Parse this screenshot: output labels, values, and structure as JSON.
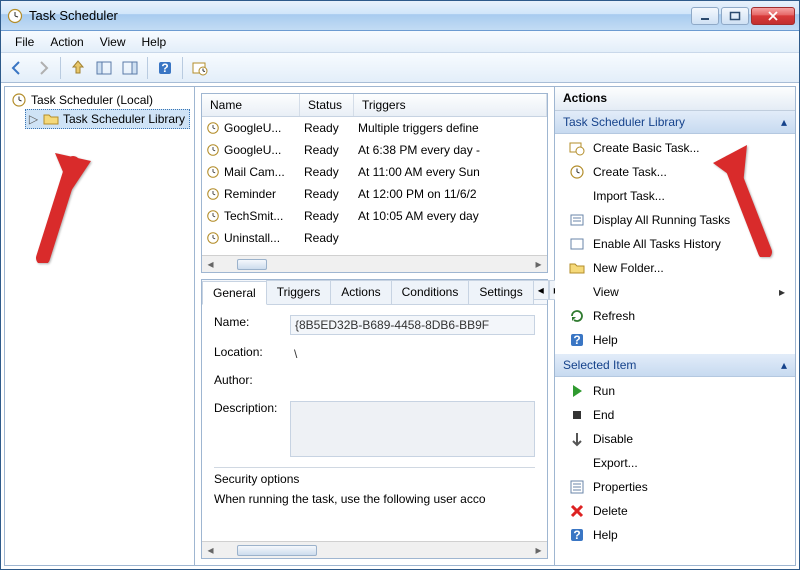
{
  "window": {
    "title": "Task Scheduler"
  },
  "menu": {
    "file": "File",
    "action": "Action",
    "view": "View",
    "help": "Help"
  },
  "tree": {
    "root": "Task Scheduler (Local)",
    "library": "Task Scheduler Library"
  },
  "columns": {
    "name": "Name",
    "status": "Status",
    "triggers": "Triggers"
  },
  "tasks": [
    {
      "name": "GoogleU...",
      "status": "Ready",
      "trigger": "Multiple triggers define"
    },
    {
      "name": "GoogleU...",
      "status": "Ready",
      "trigger": "At 6:38 PM every day - "
    },
    {
      "name": "Mail Cam...",
      "status": "Ready",
      "trigger": "At 11:00 AM every Sun"
    },
    {
      "name": "Reminder",
      "status": "Ready",
      "trigger": "At 12:00 PM on 11/6/2"
    },
    {
      "name": "TechSmit...",
      "status": "Ready",
      "trigger": "At 10:05 AM every day"
    },
    {
      "name": "Uninstall...",
      "status": "Ready",
      "trigger": ""
    }
  ],
  "tabs": {
    "general": "General",
    "triggers": "Triggers",
    "actions": "Actions",
    "conditions": "Conditions",
    "settings": "Settings"
  },
  "detail": {
    "name_label": "Name:",
    "name_value": "{8B5ED32B-B689-4458-8DB6-BB9F",
    "location_label": "Location:",
    "location_value": "\\",
    "author_label": "Author:",
    "author_value": "",
    "desc_label": "Description:",
    "desc_value": "",
    "security_legend": "Security options",
    "security_text": "When running the task, use the following user acco"
  },
  "actionsPane": {
    "header": "Actions",
    "group1": "Task Scheduler Library",
    "group2": "Selected Item",
    "g1": {
      "createBasic": "Create Basic Task...",
      "createTask": "Create Task...",
      "importTask": "Import Task...",
      "displayAll": "Display All Running Tasks",
      "enableHist": "Enable All Tasks History",
      "newFolder": "New Folder...",
      "view": "View",
      "refresh": "Refresh",
      "help": "Help"
    },
    "g2": {
      "run": "Run",
      "end": "End",
      "disable": "Disable",
      "export": "Export...",
      "properties": "Properties",
      "delete": "Delete",
      "help": "Help"
    }
  }
}
